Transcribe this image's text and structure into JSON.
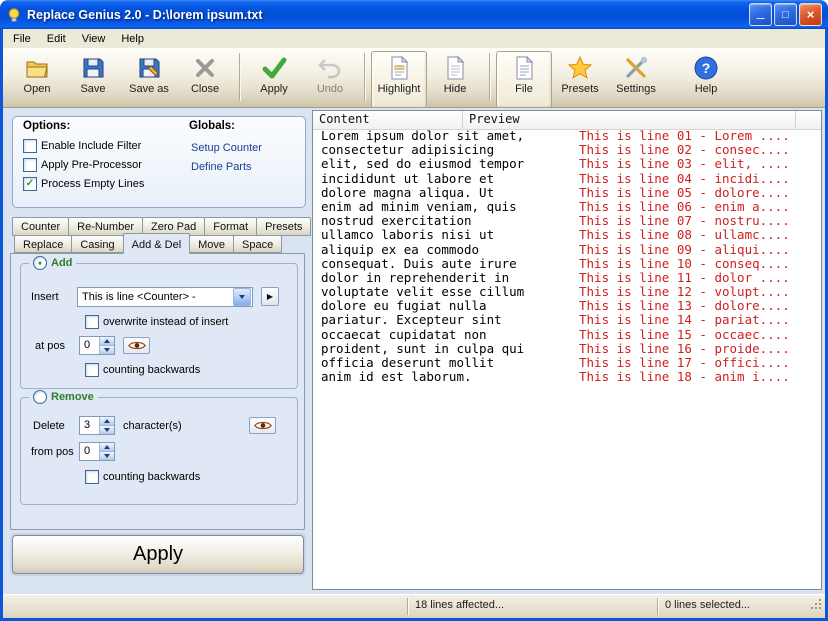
{
  "window": {
    "title": "Replace Genius 2.0 - D:\\lorem ipsum.txt"
  },
  "menu": {
    "items": [
      "File",
      "Edit",
      "View",
      "Help"
    ]
  },
  "icons": {
    "app-icon": "bulb",
    "minimize-icon": "─",
    "maximize-icon": "□",
    "close-icon": "×",
    "play-icon": "▶",
    "help-icon": "?",
    "checkmark-icon": "✓",
    "radio-dot-icon": "●",
    "combo-arrow-icon": "css-triangle-down",
    "spinner-up-icon": "css-triangle-up",
    "spinner-down-icon": "css-triangle-down",
    "eye-icon": "eye-svg"
  },
  "toolbar": {
    "buttons": [
      {
        "label": "Open"
      },
      {
        "label": "Save"
      },
      {
        "label": "Save as"
      },
      {
        "label": "Close"
      },
      {
        "label": "Apply"
      },
      {
        "label": "Undo",
        "disabled": true
      },
      {
        "label": "Highlight",
        "pressed": true
      },
      {
        "label": "Hide"
      },
      {
        "label": "File",
        "pressed": true
      },
      {
        "label": "Presets"
      },
      {
        "label": "Settings"
      },
      {
        "label": "Help"
      }
    ]
  },
  "options_panel": {
    "options_title": "Options:",
    "globals_title": "Globals:",
    "checkboxes": [
      {
        "label": "Enable Include Filter",
        "checked": false,
        "glyph": ""
      },
      {
        "label": "Apply Pre-Processor",
        "checked": false,
        "glyph": ""
      },
      {
        "label": "Process Empty Lines",
        "checked": true,
        "glyph": "✓"
      }
    ],
    "globals_links": [
      "Setup Counter",
      "Define Parts"
    ]
  },
  "tabs": {
    "row1": [
      "Counter",
      "Re-Number",
      "Zero Pad",
      "Format",
      "Presets"
    ],
    "row2": [
      "Replace",
      "Casing",
      "Add & Del",
      "Move",
      "Space"
    ],
    "active": "Add & Del"
  },
  "add_section": {
    "title": "Add",
    "selected": true,
    "radio_glyph": "●",
    "insert_label": "Insert",
    "insert_value": "This is line <Counter> -",
    "overwrite_label": "overwrite instead of insert",
    "overwrite_checked": false,
    "overwrite_glyph": "",
    "at_pos_label": "at pos",
    "at_pos_value": "0",
    "counting_label": "counting backwards",
    "counting_checked": false,
    "counting_glyph": ""
  },
  "remove_section": {
    "title": "Remove",
    "selected": false,
    "radio_glyph": "",
    "delete_label": "Delete",
    "delete_value": "3",
    "characters_label": "character(s)",
    "from_pos_label": "from pos",
    "from_pos_value": "0",
    "counting_label": "counting backwards",
    "counting_checked": false,
    "counting_glyph": ""
  },
  "apply_button_label": "Apply",
  "editor": {
    "columns": [
      "Content",
      "Preview"
    ],
    "rows": [
      {
        "content": "Lorem ipsum dolor sit amet,",
        "preview": "This is line 01 - Lorem ...."
      },
      {
        "content": "consectetur adipisicing",
        "preview": "This is line 02 - consec...."
      },
      {
        "content": "elit, sed do eiusmod tempor",
        "preview": "This is line 03 - elit, ...."
      },
      {
        "content": "incididunt ut labore et",
        "preview": "This is line 04 - incidi...."
      },
      {
        "content": "dolore magna aliqua. Ut",
        "preview": "This is line 05 - dolore...."
      },
      {
        "content": "enim ad minim veniam, quis",
        "preview": "This is line 06 - enim a...."
      },
      {
        "content": "nostrud exercitation",
        "preview": "This is line 07 - nostru...."
      },
      {
        "content": "ullamco laboris nisi ut",
        "preview": "This is line 08 - ullamc...."
      },
      {
        "content": "aliquip ex ea commodo",
        "preview": "This is line 09 - aliqui...."
      },
      {
        "content": "consequat. Duis aute irure",
        "preview": "This is line 10 - conseq...."
      },
      {
        "content": "dolor in reprehenderit in",
        "preview": "This is line 11 - dolor ...."
      },
      {
        "content": "voluptate velit esse cillum",
        "preview": "This is line 12 - volupt...."
      },
      {
        "content": "dolore eu fugiat nulla",
        "preview": "This is line 13 - dolore...."
      },
      {
        "content": "pariatur. Excepteur sint",
        "preview": "This is line 14 - pariat...."
      },
      {
        "content": "occaecat cupidatat non",
        "preview": "This is line 15 - occaec...."
      },
      {
        "content": "proident, sunt in culpa qui",
        "preview": "This is line 16 - proide...."
      },
      {
        "content": "officia deserunt mollit",
        "preview": "This is line 17 - offici...."
      },
      {
        "content": "anim id est laborum.",
        "preview": "This is line 18 - anim i...."
      }
    ]
  },
  "status_bar": {
    "affected": "18 lines affected...",
    "selected": "0 lines selected..."
  },
  "colors": {
    "preview_text": "#cf2020",
    "content_text": "#000000",
    "titlebar_blue": "#0b57d8",
    "link_blue": "#1a3e96",
    "group_title_green": "#2e7d2e",
    "checkmark_green": "#1da11d"
  }
}
